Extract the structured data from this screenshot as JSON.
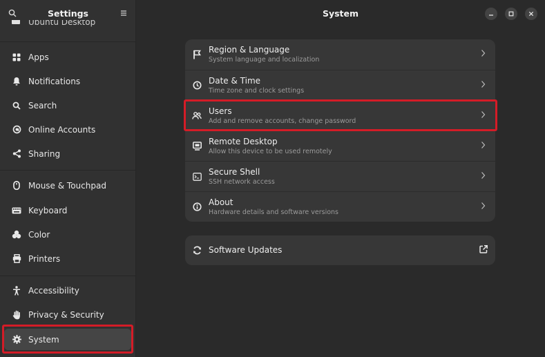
{
  "sidebar": {
    "title": "Settings",
    "partial_item": "Ubuntu Desktop",
    "items": [
      {
        "label": "Apps",
        "icon": "apps-icon"
      },
      {
        "label": "Notifications",
        "icon": "bell-icon"
      },
      {
        "label": "Search",
        "icon": "search-icon"
      },
      {
        "label": "Online Accounts",
        "icon": "at-sign-icon"
      },
      {
        "label": "Sharing",
        "icon": "share-icon"
      },
      {
        "label": "Mouse & Touchpad",
        "icon": "mouse-icon"
      },
      {
        "label": "Keyboard",
        "icon": "keyboard-icon"
      },
      {
        "label": "Color",
        "icon": "palette-icon"
      },
      {
        "label": "Printers",
        "icon": "printer-icon"
      },
      {
        "label": "Accessibility",
        "icon": "accessibility-icon"
      },
      {
        "label": "Privacy & Security",
        "icon": "hand-icon"
      },
      {
        "label": "System",
        "icon": "gear-icon"
      }
    ],
    "selected": "System"
  },
  "main": {
    "title": "System",
    "rows": [
      {
        "title": "Region & Language",
        "subtitle": "System language and localization",
        "icon": "flag-icon"
      },
      {
        "title": "Date & Time",
        "subtitle": "Time zone and clock settings",
        "icon": "clock-icon"
      },
      {
        "title": "Users",
        "subtitle": "Add and remove accounts, change password",
        "icon": "users-icon"
      },
      {
        "title": "Remote Desktop",
        "subtitle": "Allow this device to be used remotely",
        "icon": "remote-desktop-icon"
      },
      {
        "title": "Secure Shell",
        "subtitle": "SSH network access",
        "icon": "terminal-icon"
      },
      {
        "title": "About",
        "subtitle": "Hardware details and software versions",
        "icon": "info-icon"
      }
    ],
    "updates": {
      "title": "Software Updates",
      "icon": "refresh-icon",
      "action_icon": "external-link-icon"
    }
  },
  "colors": {
    "highlight": "#d41c27",
    "sidebar_bg": "#313131",
    "main_bg": "#2a2a2a",
    "card_bg": "#373737"
  }
}
